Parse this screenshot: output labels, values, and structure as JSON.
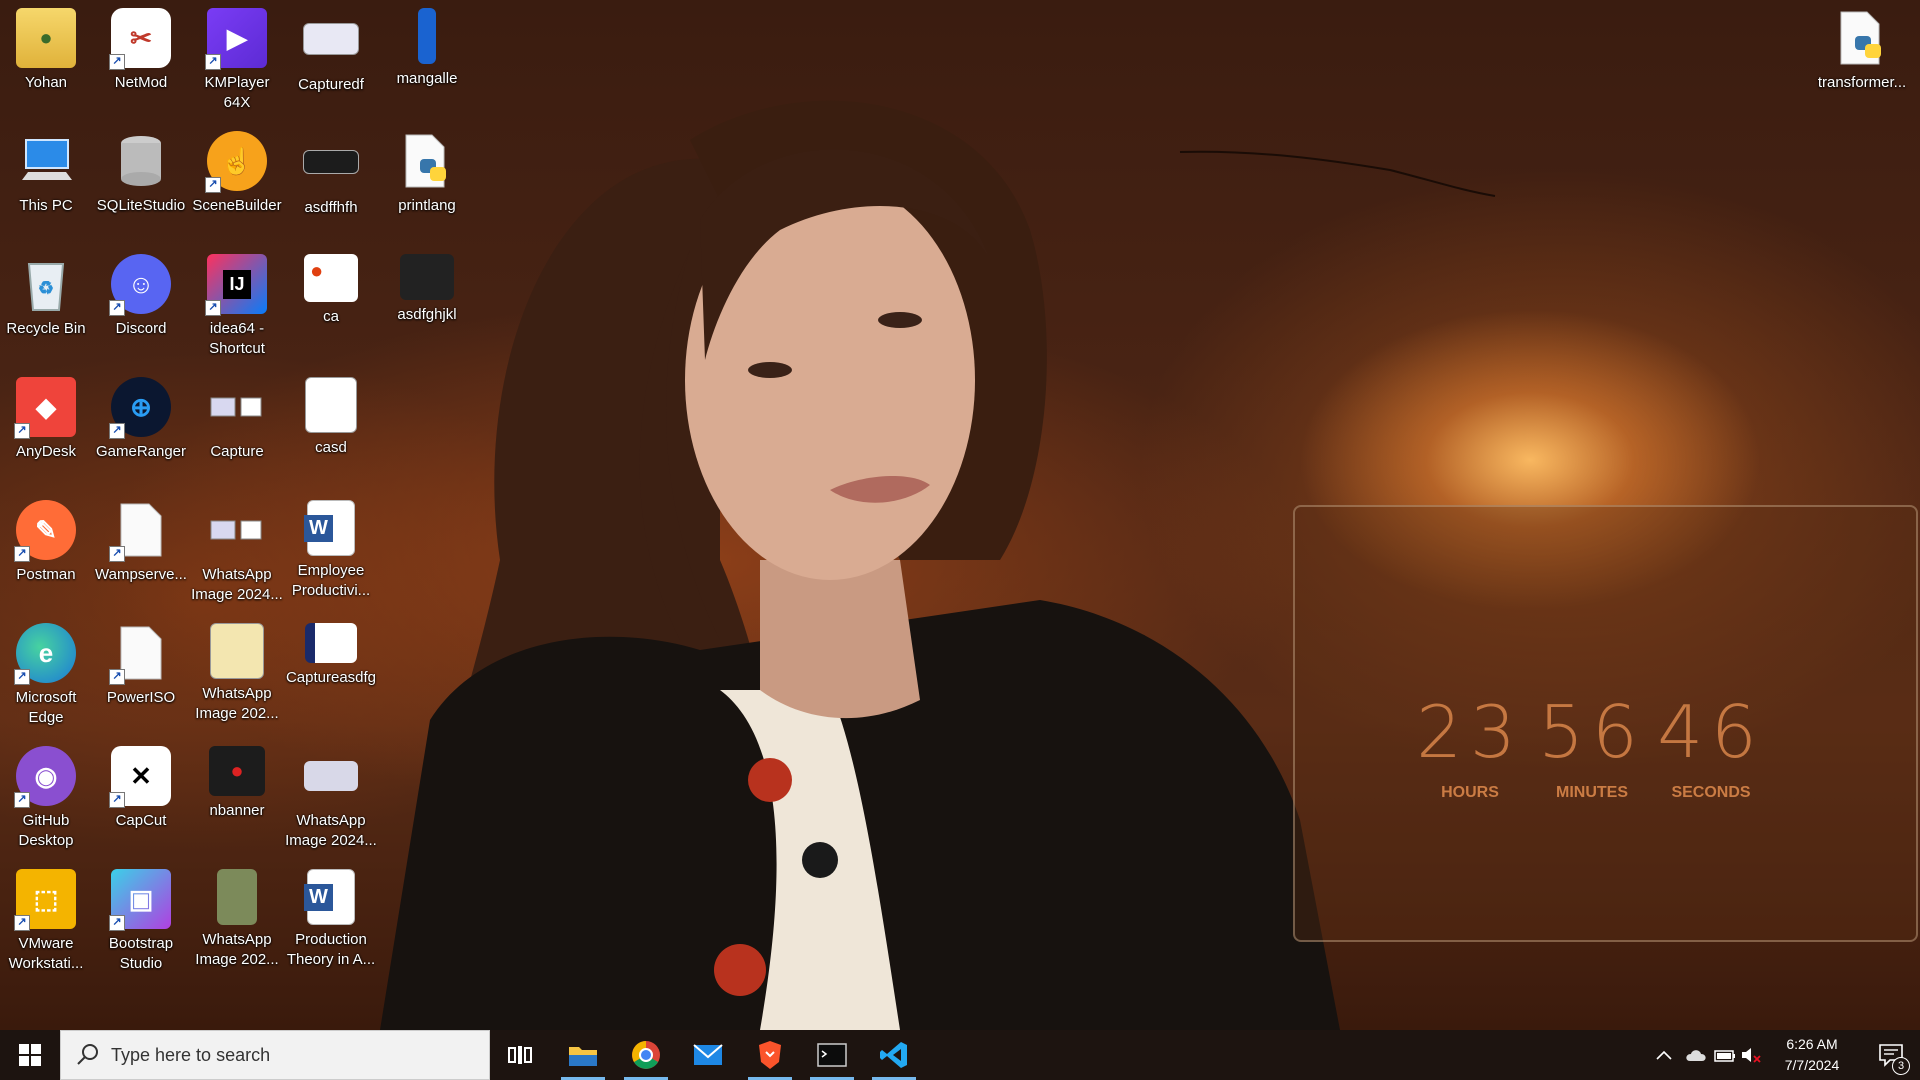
{
  "desktop": {
    "icons": [
      {
        "label": "Yohan"
      },
      {
        "label": "NetMod"
      },
      {
        "label": "KMPlayer 64X"
      },
      {
        "label": "Capturedf"
      },
      {
        "label": "mangalle"
      },
      {
        "label": "This PC"
      },
      {
        "label": "SQLiteStudio"
      },
      {
        "label": "SceneBuilder"
      },
      {
        "label": "asdffhfh"
      },
      {
        "label": "printlang"
      },
      {
        "label": "Recycle Bin"
      },
      {
        "label": "Discord"
      },
      {
        "label": "idea64 - Shortcut"
      },
      {
        "label": "ca"
      },
      {
        "label": "asdfghjkl"
      },
      {
        "label": "AnyDesk"
      },
      {
        "label": "GameRanger"
      },
      {
        "label": "Capture"
      },
      {
        "label": "casd"
      },
      {
        "label": "Postman"
      },
      {
        "label": "Wampserve..."
      },
      {
        "label": "WhatsApp Image 2024..."
      },
      {
        "label": "Employee Productivi..."
      },
      {
        "label": "Microsoft Edge"
      },
      {
        "label": "PowerISO"
      },
      {
        "label": "WhatsApp Image 202..."
      },
      {
        "label": "Captureasdfg"
      },
      {
        "label": "GitHub Desktop"
      },
      {
        "label": "CapCut"
      },
      {
        "label": "nbanner"
      },
      {
        "label": "WhatsApp Image 2024..."
      },
      {
        "label": "VMware Workstati..."
      },
      {
        "label": "Bootstrap Studio"
      },
      {
        "label": "WhatsApp Image 202..."
      },
      {
        "label": "Production Theory in A..."
      },
      {
        "label": "transformer..."
      }
    ]
  },
  "clock_widget": {
    "hours": "23",
    "minutes": "56",
    "seconds": "46",
    "hours_label": "HOURS",
    "minutes_label": "MINUTES",
    "seconds_label": "SECONDS"
  },
  "taskbar": {
    "search_placeholder": "Type here to search",
    "time": "6:26 AM",
    "date": "7/7/2024",
    "notification_count": "3"
  }
}
